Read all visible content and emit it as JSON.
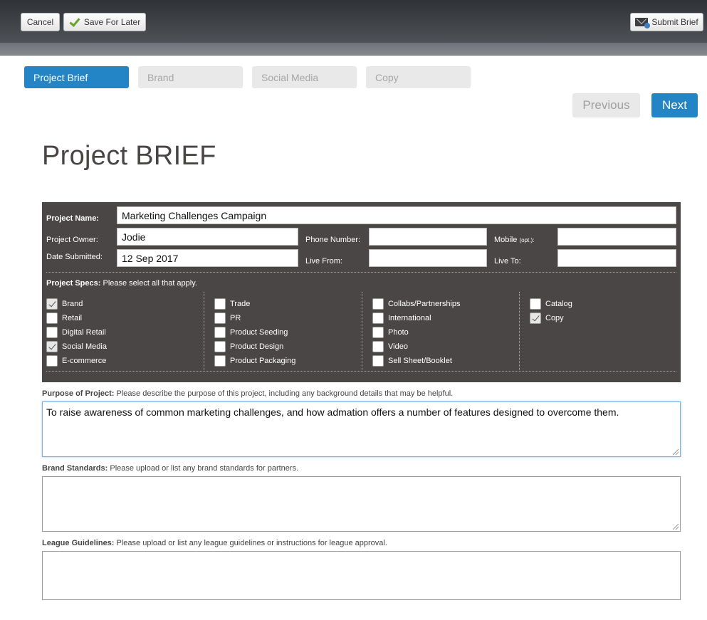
{
  "toolbar": {
    "cancel_label": "Cancel",
    "save_label": "Save For Later",
    "submit_label": "Submit Brief"
  },
  "steps": [
    {
      "label": "Project Brief",
      "active": true
    },
    {
      "label": "Brand",
      "active": false
    },
    {
      "label": "Social Media",
      "active": false
    },
    {
      "label": "Copy",
      "active": false
    }
  ],
  "nav": {
    "previous_label": "Previous",
    "next_label": "Next"
  },
  "page_title": "Project BRIEF",
  "form": {
    "project_name_label": "Project Name:",
    "project_name": "Marketing Challenges Campaign",
    "project_owner_label": "Project Owner:",
    "project_owner": "Jodie",
    "date_submitted_label": "Date Submitted:",
    "date_submitted": "12 Sep 2017",
    "phone_label": "Phone Number:",
    "phone": "",
    "mobile_label": "Mobile",
    "mobile_opt": "(opt.):",
    "mobile": "",
    "live_from_label": "Live From:",
    "live_from": "",
    "live_to_label": "Live To:",
    "live_to": ""
  },
  "specs": {
    "label": "Project Specs:",
    "hint": "Please select all that apply.",
    "columns": [
      [
        {
          "label": "Brand",
          "checked": true
        },
        {
          "label": "Retail",
          "checked": false
        },
        {
          "label": "Digital Retail",
          "checked": false
        },
        {
          "label": "Social Media",
          "checked": true
        },
        {
          "label": "E-commerce",
          "checked": false
        }
      ],
      [
        {
          "label": "Trade",
          "checked": false
        },
        {
          "label": "PR",
          "checked": false
        },
        {
          "label": "Product Seeding",
          "checked": false
        },
        {
          "label": "Product Design",
          "checked": false
        },
        {
          "label": "Product Packaging",
          "checked": false
        }
      ],
      [
        {
          "label": "Collabs/Partnerships",
          "checked": false
        },
        {
          "label": "International",
          "checked": false
        },
        {
          "label": "Photo",
          "checked": false
        },
        {
          "label": "Video",
          "checked": false
        },
        {
          "label": "Sell Sheet/Booklet",
          "checked": false
        }
      ],
      [
        {
          "label": "Catalog",
          "checked": false
        },
        {
          "label": "Copy",
          "checked": true
        }
      ]
    ]
  },
  "purpose": {
    "label": "Purpose of Project:",
    "hint": "Please describe the purpose of this project, including any background details that may be helpful.",
    "value": "To raise awareness of common marketing challenges, and how admation offers a number of features designed to overcome them."
  },
  "brand_standards": {
    "label": "Brand Standards:",
    "hint": "Please upload or list any brand standards for partners.",
    "value": ""
  },
  "league_guidelines": {
    "label": "League Guidelines:",
    "hint": "Please upload or list any league guidelines or instructions for league approval.",
    "value": ""
  },
  "colors": {
    "accent": "#2384c6",
    "panel": "#4b4646"
  }
}
